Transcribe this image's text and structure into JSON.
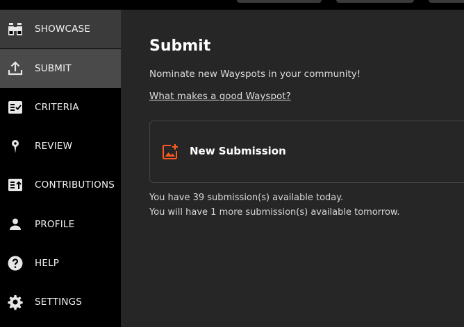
{
  "sidebar": {
    "items": [
      {
        "label": "SHOWCASE",
        "icon": "binoculars-icon"
      },
      {
        "label": "SUBMIT",
        "icon": "upload-icon"
      },
      {
        "label": "CRITERIA",
        "icon": "checklist-icon"
      },
      {
        "label": "REVIEW",
        "icon": "map-pin-icon"
      },
      {
        "label": "CONTRIBUTIONS",
        "icon": "contributions-icon"
      },
      {
        "label": "PROFILE",
        "icon": "person-icon"
      },
      {
        "label": "HELP",
        "icon": "help-icon"
      },
      {
        "label": "SETTINGS",
        "icon": "gear-icon"
      }
    ]
  },
  "main": {
    "title": "Submit",
    "subtitle": "Nominate new Wayspots in your community!",
    "link": "What makes a good Wayspot?",
    "card_label": "New Submission",
    "note_today": "You have 39 submission(s) available today.",
    "note_tomorrow": "You will have 1 more submission(s) available tomorrow."
  },
  "colors": {
    "accent": "#ff5a1f",
    "sidebar_bg": "#000000",
    "main_bg": "#262626",
    "active_item_bg": "#4a4a4a"
  }
}
